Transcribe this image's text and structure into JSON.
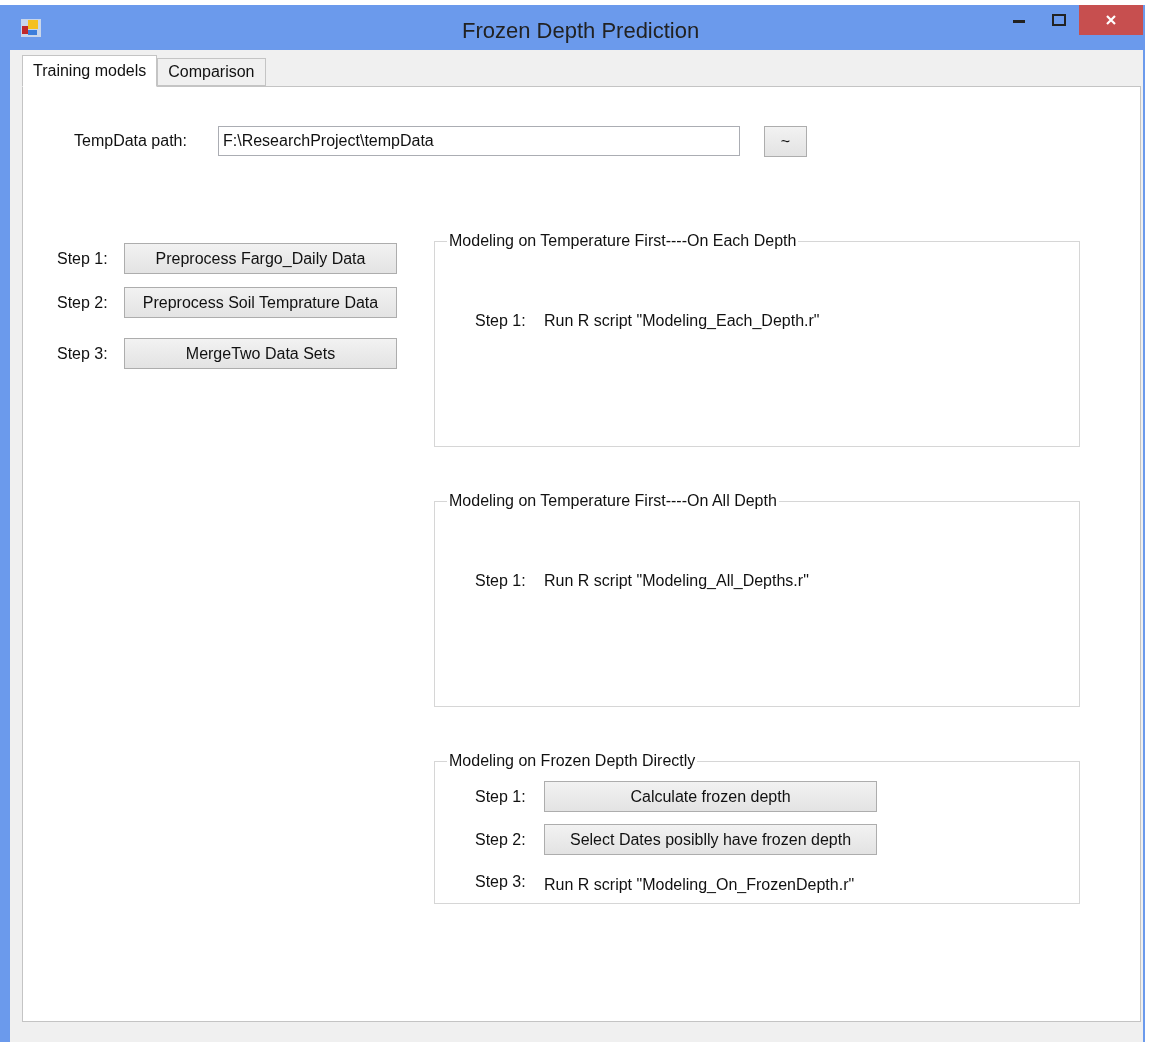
{
  "window": {
    "title": "Frozen Depth Prediction"
  },
  "tabs": [
    {
      "label": "Training models",
      "selected": true
    },
    {
      "label": "Comparison",
      "selected": false
    }
  ],
  "path_field": {
    "label": "TempData path:",
    "value": "F:\\ResearchProject\\tempData"
  },
  "browse_button": "~",
  "preprocess_steps": [
    {
      "label": "Step 1:",
      "button": "Preprocess Fargo_Daily Data"
    },
    {
      "label": "Step 2:",
      "button": "Preprocess Soil Temprature Data"
    },
    {
      "label": "Step 3:",
      "button": "MergeTwo Data Sets"
    }
  ],
  "groups": [
    {
      "title": "Modeling on Temperature First----On Each Depth",
      "steps": [
        {
          "label": "Step 1:",
          "kind": "text",
          "text": "Run R script \"Modeling_Each_Depth.r\""
        }
      ]
    },
    {
      "title": "Modeling on Temperature First----On All Depth",
      "steps": [
        {
          "label": "Step 1:",
          "kind": "text",
          "text": "Run R script \"Modeling_All_Depths.r\""
        }
      ]
    },
    {
      "title": "Modeling on Frozen Depth Directly",
      "steps": [
        {
          "label": "Step 1:",
          "kind": "button",
          "text": "Calculate frozen depth"
        },
        {
          "label": "Step 2:",
          "kind": "button",
          "text": "Select Dates posiblly have frozen depth"
        },
        {
          "label": "Step 3:",
          "kind": "text",
          "text": "Run R script \"Modeling_On_FrozenDepth.r\""
        }
      ]
    }
  ]
}
